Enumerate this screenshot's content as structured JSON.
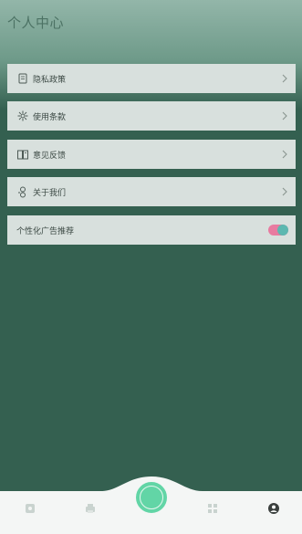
{
  "header": {
    "title": "个人中心"
  },
  "menu": {
    "privacy": {
      "label": "隐私政策",
      "icon": "document-icon"
    },
    "terms": {
      "label": "使用条款",
      "icon": "settings-icon"
    },
    "feedback": {
      "label": "意见反馈",
      "icon": "book-icon"
    },
    "about": {
      "label": "关于我们",
      "icon": "person-icon"
    },
    "ads": {
      "label": "个性化广告推荐",
      "toggle_on": true
    }
  },
  "tabbar": {
    "tabs": [
      "home-icon",
      "print-icon",
      "scan-button",
      "grid-icon",
      "profile-icon"
    ],
    "active": "profile-icon"
  },
  "colors": {
    "background": "#346050",
    "accent": "#62d5a6",
    "toggle_track": "#e87ba0",
    "toggle_knob": "#5cb8b0"
  }
}
